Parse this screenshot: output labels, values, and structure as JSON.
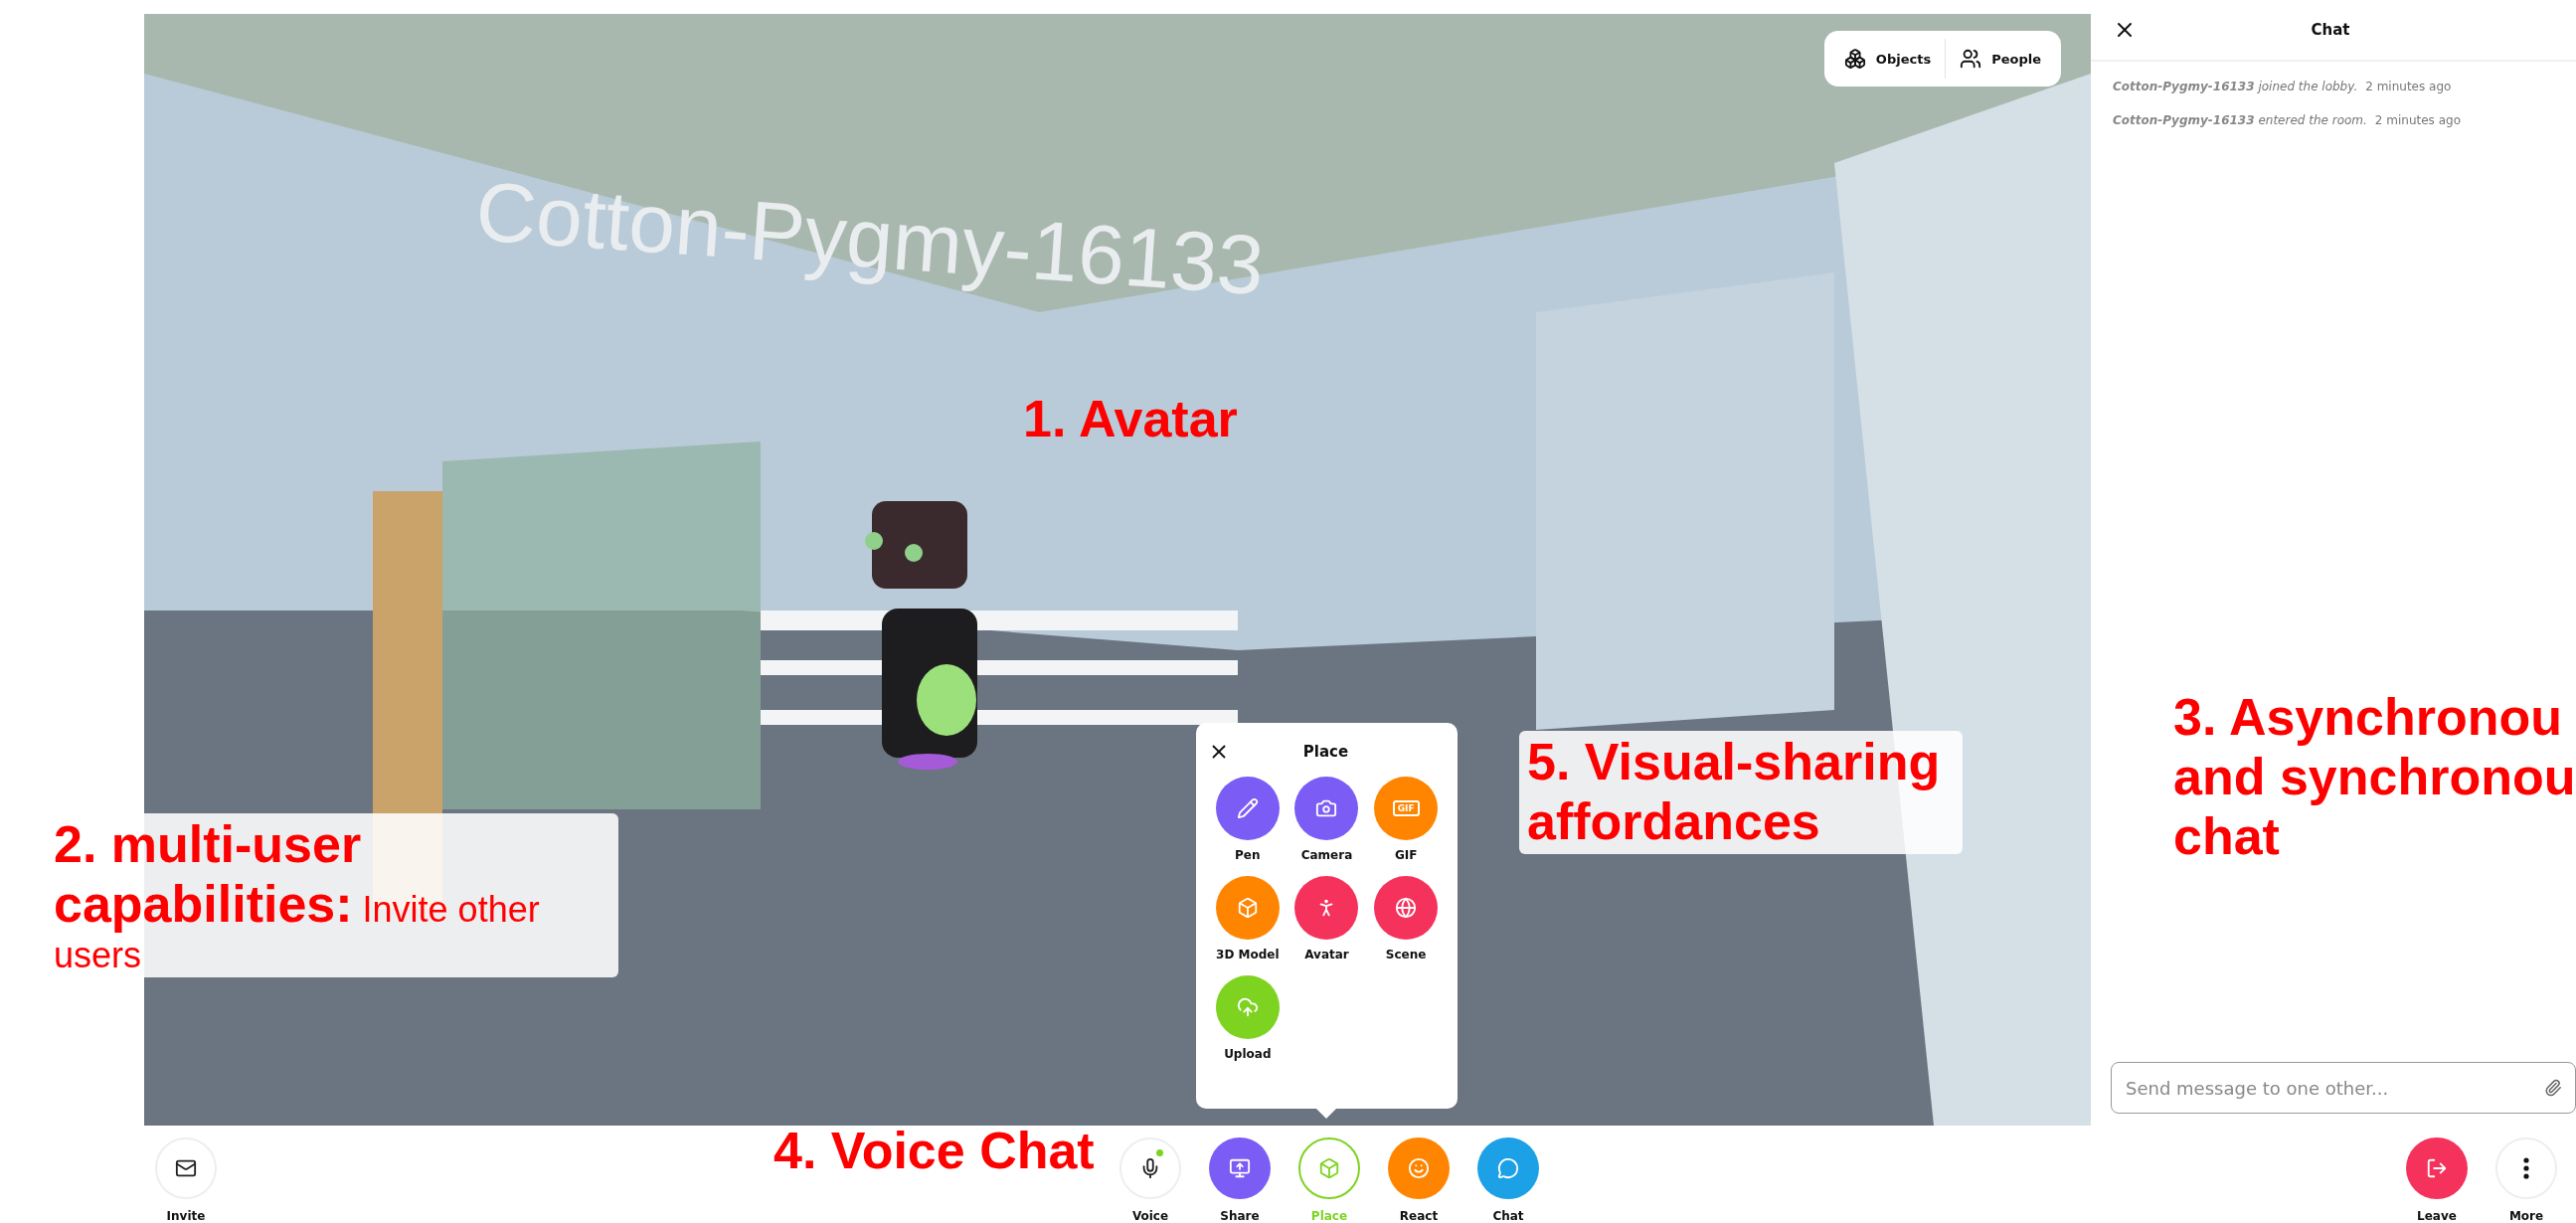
{
  "scene": {
    "name_tag": "Cotton-Pygmy-16133",
    "view_buttons": [
      {
        "label": "Objects"
      },
      {
        "label": "People"
      }
    ]
  },
  "place_menu": {
    "title": "Place",
    "items": [
      {
        "label": "Pen",
        "color": "#7b5cf5"
      },
      {
        "label": "Camera",
        "color": "#7b5cf5"
      },
      {
        "label": "GIF",
        "color": "#ff8500",
        "icon_text": "GIF"
      },
      {
        "label": "3D Model",
        "color": "#ff8500"
      },
      {
        "label": "Avatar",
        "color": "#f5325c"
      },
      {
        "label": "Scene",
        "color": "#f5325c"
      },
      {
        "label": "Upload",
        "color": "#7ed321"
      }
    ]
  },
  "chat": {
    "title": "Chat",
    "messages": [
      {
        "author": "Cotton-Pygmy-16133",
        "text": "joined the lobby.",
        "time": "2 minutes ago"
      },
      {
        "author": "Cotton-Pygmy-16133",
        "text": "entered the room.",
        "time": "2 minutes ago"
      }
    ],
    "input": {
      "placeholder": "Send message to one other..."
    }
  },
  "toolbar": {
    "left": [
      {
        "label": "Invite",
        "color": "#ffffff",
        "selected": false,
        "indicator": false
      }
    ],
    "center": [
      {
        "label": "Voice",
        "color": "#ffffff",
        "selected": false,
        "indicator": true
      },
      {
        "label": "Share",
        "color": "#7b5cf5",
        "selected": false,
        "indicator": false
      },
      {
        "label": "Place",
        "color": "#7ed321",
        "selected": true,
        "indicator": false
      },
      {
        "label": "React",
        "color": "#ff8500",
        "selected": false,
        "indicator": false
      },
      {
        "label": "Chat",
        "color": "#1da1e6",
        "selected": false,
        "indicator": false
      }
    ],
    "right": [
      {
        "label": "Leave",
        "color": "#f5325c",
        "selected": false,
        "indicator": false
      },
      {
        "label": "More",
        "color": "#ffffff",
        "selected": false,
        "indicator": false
      }
    ]
  },
  "annotations": [
    {
      "text": "1. Avatar"
    },
    {
      "text": "**2. multi-user capabilities:** Invite other users"
    },
    {
      "text": "3. Asynchronou and synchronou chat"
    },
    {
      "text": "4. Voice Chat"
    },
    {
      "text": "5. Visual-sharing affordances"
    }
  ]
}
